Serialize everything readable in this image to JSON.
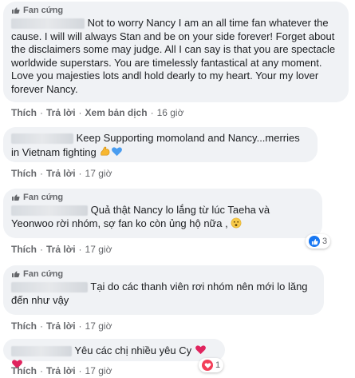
{
  "labels": {
    "badge": "Fan cứng",
    "like": "Thích",
    "reply": "Trả lời",
    "see_translation": "Xem bản dịch",
    "dot": "·"
  },
  "colors": {
    "bubble": "#f0f2f5",
    "meta_text": "#65676b",
    "like_blue": "#1877f2",
    "love_red": "#f33e58",
    "heart_red": "#e0245e",
    "muscle_yellow": "#f7b731",
    "blue_heart": "#4a9df0"
  },
  "comments": [
    {
      "badge": true,
      "text": "Not to worry Nancy I am an all time fan whatever the cause. I will will always Stan and be on your side forever! Forget about the disclaimers some may judge. All I can say is that you are spectacle worldwide superstars. You are timelessly fantastical at any moment. Love you majesties lots andl hold dearly to my heart. Your my lover forever Nancy.",
      "time": "16 giờ",
      "has_translation": true
    },
    {
      "badge": false,
      "text": "Keep Supporting momoland and Nancy...merries in Vietnam fighting",
      "emoji": [
        "flexed-biceps-icon",
        "blue-heart-icon"
      ],
      "time": "17 giờ",
      "has_translation": false
    },
    {
      "badge": true,
      "text": "Quả thật Nancy lo lắng từ lúc Taeha và Yeonwoo rời nhóm, sợ fan ko còn ủng hộ nữa ,",
      "emoji": [
        "worried-face-icon"
      ],
      "reaction": {
        "icon": "like-icon",
        "count": "3"
      },
      "time": "17 giờ",
      "has_translation": false
    },
    {
      "badge": true,
      "text": "Tại do các thanh viên rơi nhóm nên mới lo lăng đến như vậy",
      "time": "17 giờ",
      "has_translation": false
    },
    {
      "badge": false,
      "text": "Yêu các chị nhiều yêu Cy",
      "emoji": [
        "red-heart-icon",
        "red-heart-icon"
      ],
      "reaction": {
        "icon": "love-icon",
        "count": "1"
      },
      "time": "17 giờ",
      "has_translation": false
    }
  ]
}
